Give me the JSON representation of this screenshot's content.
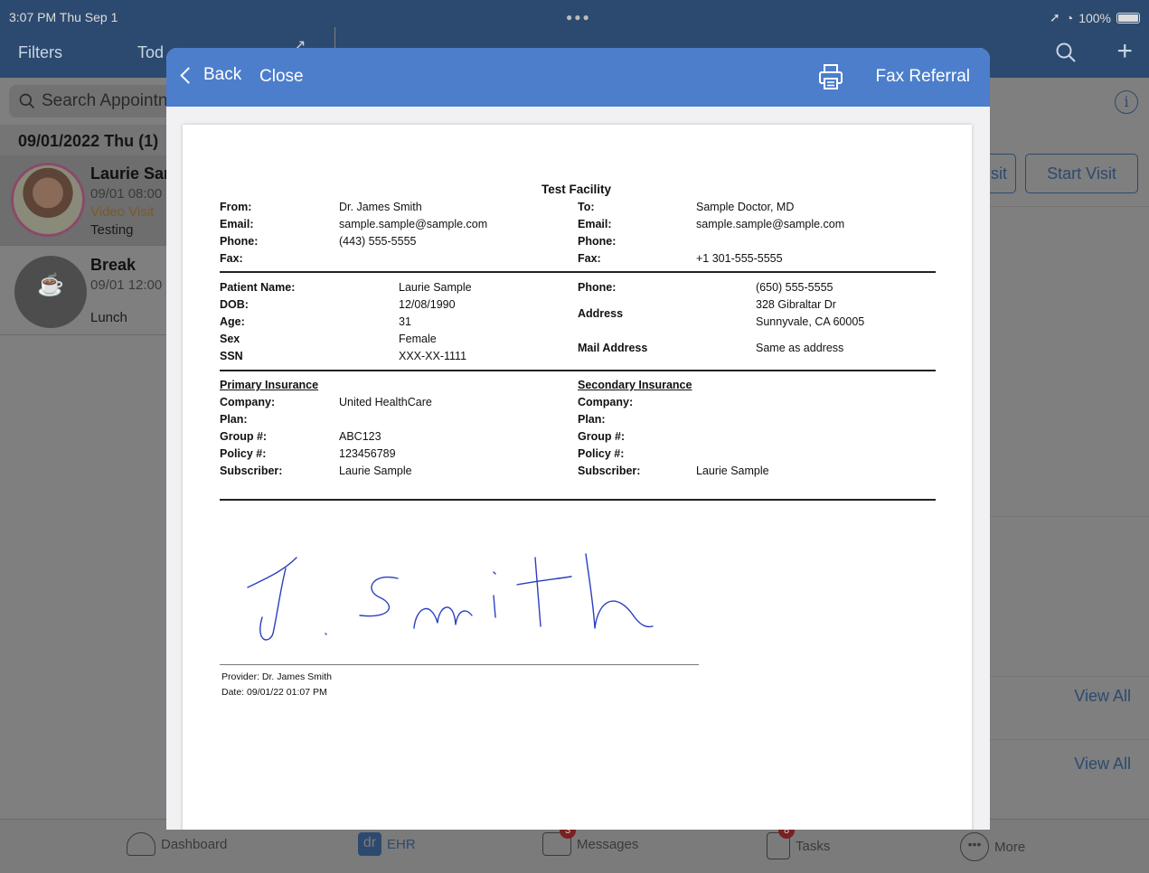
{
  "status_bar": {
    "time": "3:07 PM  Thu Sep 1",
    "battery": "100%"
  },
  "left_header": {
    "filters": "Filters",
    "today": "Tod"
  },
  "search": {
    "placeholder": "Search Appointn"
  },
  "appointments": {
    "date_header": "09/01/2022 Thu (1)",
    "items": [
      {
        "name": "Laurie Sar",
        "time": "09/01 08:00",
        "type": "Video Visit",
        "note": "Testing"
      },
      {
        "name": "Break",
        "time": "09/01 12:00",
        "type": "",
        "note": "Lunch"
      }
    ]
  },
  "right_pane": {
    "btn_partial": "sit",
    "start_visit": "Start Visit",
    "view_all_1": "View All",
    "view_all_2": "View All"
  },
  "modal": {
    "back": "Back",
    "close": "Close",
    "fax_referral": "Fax Referral"
  },
  "document": {
    "facility": "Test Facility",
    "from": {
      "label": "From:",
      "value": "Dr. James Smith"
    },
    "from_email": {
      "label": "Email:",
      "value": "sample.sample@sample.com"
    },
    "from_phone": {
      "label": "Phone:",
      "value": "(443) 555-5555"
    },
    "from_fax": {
      "label": "Fax:",
      "value": ""
    },
    "to": {
      "label": "To:",
      "value": "Sample Doctor, MD"
    },
    "to_email": {
      "label": "Email:",
      "value": "sample.sample@sample.com"
    },
    "to_phone": {
      "label": "Phone:",
      "value": ""
    },
    "to_fax": {
      "label": "Fax:",
      "value": "+1 301-555-5555"
    },
    "patient_name": {
      "label": "Patient Name:",
      "value": "Laurie Sample"
    },
    "dob": {
      "label": "DOB:",
      "value": "12/08/1990"
    },
    "age": {
      "label": "Age:",
      "value": "31"
    },
    "sex": {
      "label": "Sex",
      "value": "Female"
    },
    "ssn": {
      "label": "SSN",
      "value": "XXX-XX-1111"
    },
    "patient_phone": {
      "label": "Phone:",
      "value": "(650) 555-5555"
    },
    "address": {
      "label": "Address",
      "line1": "328 Gibraltar Dr",
      "line2": "Sunnyvale, CA 60005"
    },
    "mail_address": {
      "label": "Mail Address",
      "value": "Same as address"
    },
    "primary": {
      "title": "Primary Insurance",
      "company": {
        "label": "Company:",
        "value": "United HealthCare"
      },
      "plan": {
        "label": "Plan:",
        "value": ""
      },
      "group": {
        "label": "Group #:",
        "value": "ABC123"
      },
      "policy": {
        "label": "Policy #:",
        "value": "123456789"
      },
      "subscriber": {
        "label": "Subscriber:",
        "value": "Laurie Sample"
      }
    },
    "secondary": {
      "title": "Secondary Insurance",
      "company": {
        "label": "Company:",
        "value": ""
      },
      "plan": {
        "label": "Plan:",
        "value": ""
      },
      "group": {
        "label": "Group #:",
        "value": ""
      },
      "policy": {
        "label": "Policy #:",
        "value": ""
      },
      "subscriber": {
        "label": "Subscriber:",
        "value": "Laurie Sample"
      }
    },
    "signature": "J.Smith",
    "provider": "Provider: Dr. James Smith",
    "date": "Date: 09/01/22 01:07 PM"
  },
  "tabbar": {
    "dashboard": "Dashboard",
    "ehr": "EHR",
    "ehr_icon_text": "dr",
    "messages": "Messages",
    "messages_badge": "3",
    "tasks": "Tasks",
    "tasks_badge": "8",
    "more": "More"
  }
}
